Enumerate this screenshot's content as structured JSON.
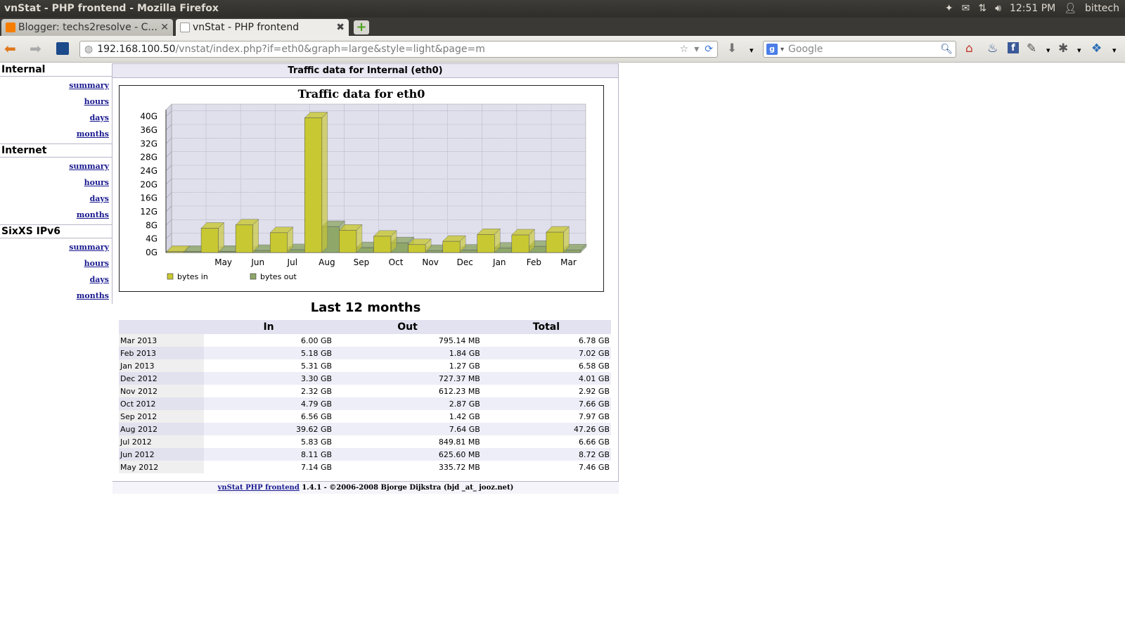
{
  "window": {
    "title": "vnStat - PHP frontend - Mozilla Firefox"
  },
  "tray": {
    "time": "12:51 PM",
    "user": "bittech"
  },
  "tabs": [
    {
      "label": "Blogger: techs2resolve - C...",
      "active": false
    },
    {
      "label": "vnStat - PHP frontend",
      "active": true
    }
  ],
  "nav": {
    "url_host": "192.168.100.50",
    "url_path": "/vnstat/index.php?if=eth0&graph=large&style=light&page=m",
    "search_placeholder": "Google",
    "search_engine": "g"
  },
  "sidebar": [
    {
      "name": "Internal",
      "links": [
        "summary",
        "hours",
        "days",
        "months"
      ]
    },
    {
      "name": "Internet",
      "links": [
        "summary",
        "hours",
        "days",
        "months"
      ]
    },
    {
      "name": "SixXS IPv6",
      "links": [
        "summary",
        "hours",
        "days",
        "months"
      ]
    }
  ],
  "page": {
    "heading": "Traffic data for Internal (eth0)",
    "table_title": "Last 12 months",
    "footer_link": "vnStat PHP frontend",
    "footer_text": " 1.4.1 - ©2006-2008 Bjorge Dijkstra (bjd _at_ jooz.net)"
  },
  "table": {
    "headers": [
      "",
      "In",
      "Out",
      "Total"
    ],
    "rows": [
      [
        "Mar 2013",
        "6.00 GB",
        "795.14 MB",
        "6.78 GB"
      ],
      [
        "Feb 2013",
        "5.18 GB",
        "1.84 GB",
        "7.02 GB"
      ],
      [
        "Jan 2013",
        "5.31 GB",
        "1.27 GB",
        "6.58 GB"
      ],
      [
        "Dec 2012",
        "3.30 GB",
        "727.37 MB",
        "4.01 GB"
      ],
      [
        "Nov 2012",
        "2.32 GB",
        "612.23 MB",
        "2.92 GB"
      ],
      [
        "Oct 2012",
        "4.79 GB",
        "2.87 GB",
        "7.66 GB"
      ],
      [
        "Sep 2012",
        "6.56 GB",
        "1.42 GB",
        "7.97 GB"
      ],
      [
        "Aug 2012",
        "39.62 GB",
        "7.64 GB",
        "47.26 GB"
      ],
      [
        "Jul 2012",
        "5.83 GB",
        "849.81 MB",
        "6.66 GB"
      ],
      [
        "Jun 2012",
        "8.11 GB",
        "625.60 MB",
        "8.72 GB"
      ],
      [
        "May 2012",
        "7.14 GB",
        "335.72 MB",
        "7.46 GB"
      ]
    ]
  },
  "chart_data": {
    "type": "bar",
    "title": "Traffic data for eth0",
    "categories": [
      "",
      "May",
      "Jun",
      "Jul",
      "Aug",
      "Sep",
      "Oct",
      "Nov",
      "Dec",
      "Jan",
      "Feb",
      "Mar"
    ],
    "series": [
      {
        "name": "bytes in",
        "color": "#c8c832",
        "values": [
          0,
          7.14,
          8.11,
          5.83,
          39.62,
          6.56,
          4.79,
          2.32,
          3.3,
          5.31,
          5.18,
          6.0
        ]
      },
      {
        "name": "bytes out",
        "color": "#8fa86a",
        "values": [
          0,
          0.33,
          0.61,
          0.83,
          7.64,
          1.42,
          2.87,
          0.6,
          0.71,
          1.27,
          1.84,
          0.78
        ]
      }
    ],
    "yticks": [
      "0G",
      "4G",
      "8G",
      "12G",
      "16G",
      "20G",
      "24G",
      "28G",
      "32G",
      "36G",
      "40G"
    ],
    "ylim": [
      0,
      42
    ],
    "grid": true,
    "legend": "bottom-left"
  },
  "colors": {
    "link": "#1a1a90",
    "header_bg": "#e3e2f1",
    "bar_in": "#c8c832",
    "bar_out": "#8fa86a"
  }
}
